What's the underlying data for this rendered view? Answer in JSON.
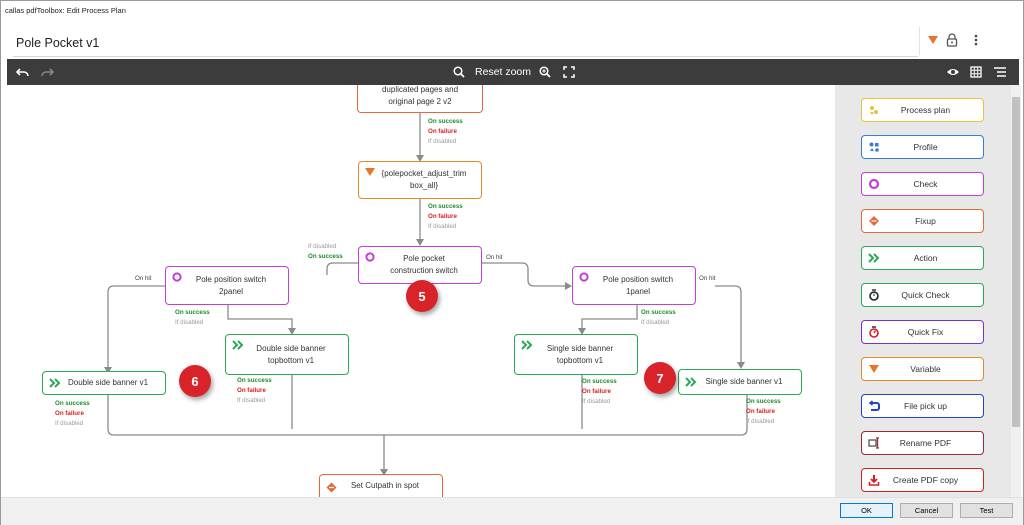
{
  "window": {
    "title": "callas pdfToolbox: Edit Process Plan"
  },
  "plan": {
    "name": "Pole Pocket v1"
  },
  "toolbar": {
    "reset_zoom": "Reset zoom"
  },
  "nodes": {
    "dup": {
      "line1": "duplicated pages and",
      "line2": "original page 2 v2"
    },
    "var": {
      "line1": "{polepocket_adjust_trim",
      "line2": "box_all}"
    },
    "ppc": {
      "line1": "Pole pocket",
      "line2": "construction switch"
    },
    "pp2": {
      "line1": "Pole position switch",
      "line2": "2panel"
    },
    "pp1": {
      "line1": "Pole position switch",
      "line2": "1panel"
    },
    "dsbt": {
      "line1": "Double side banner",
      "line2": "topbottom v1"
    },
    "ssbt": {
      "line1": "Single side banner",
      "line2": "topbottom v1"
    },
    "dsb": {
      "label": "Double side banner v1"
    },
    "ssb": {
      "label": "Single side banner v1"
    },
    "cut": {
      "label": "Set Cutpath in spot"
    }
  },
  "conn": {
    "on_success": "On success",
    "on_failure": "On failure",
    "if_disabled": "If disabled",
    "on_hit": "On hit"
  },
  "badges": [
    "5",
    "6",
    "7"
  ],
  "palette": [
    {
      "label": "Process plan",
      "color": "#e8c33a",
      "icon": "process-plan-icon"
    },
    {
      "label": "Profile",
      "color": "#3a7bd5",
      "icon": "profile-icon"
    },
    {
      "label": "Check",
      "color": "#c23ed6",
      "icon": "check-icon"
    },
    {
      "label": "Fixup",
      "color": "#e8683a",
      "icon": "fixup-icon"
    },
    {
      "label": "Action",
      "color": "#2aa857",
      "icon": "action-icon"
    },
    {
      "label": "Quick Check",
      "color": "#2aa857",
      "icon": "quick-check-icon"
    },
    {
      "label": "Quick Fix",
      "color": "#7b2fd0",
      "icon": "quick-fix-icon"
    },
    {
      "label": "Variable",
      "color": "#e08a2a",
      "icon": "variable-icon"
    },
    {
      "label": "File pick up",
      "color": "#2343c8",
      "icon": "file-pick-up-icon"
    },
    {
      "label": "Rename PDF",
      "color": "#9a2a3a",
      "icon": "rename-pdf-icon"
    },
    {
      "label": "Create PDF copy",
      "color": "#d42020",
      "icon": "create-pdf-copy-icon"
    }
  ],
  "footer": {
    "ok": "OK",
    "cancel": "Cancel",
    "test": "Test"
  },
  "colors": {
    "check": "#c23ed6",
    "action": "#2aa857",
    "fixup": "#e8683a",
    "variable": "#e08a2a",
    "badge": "#d8232a",
    "toolbar": "#3c3c3c"
  }
}
